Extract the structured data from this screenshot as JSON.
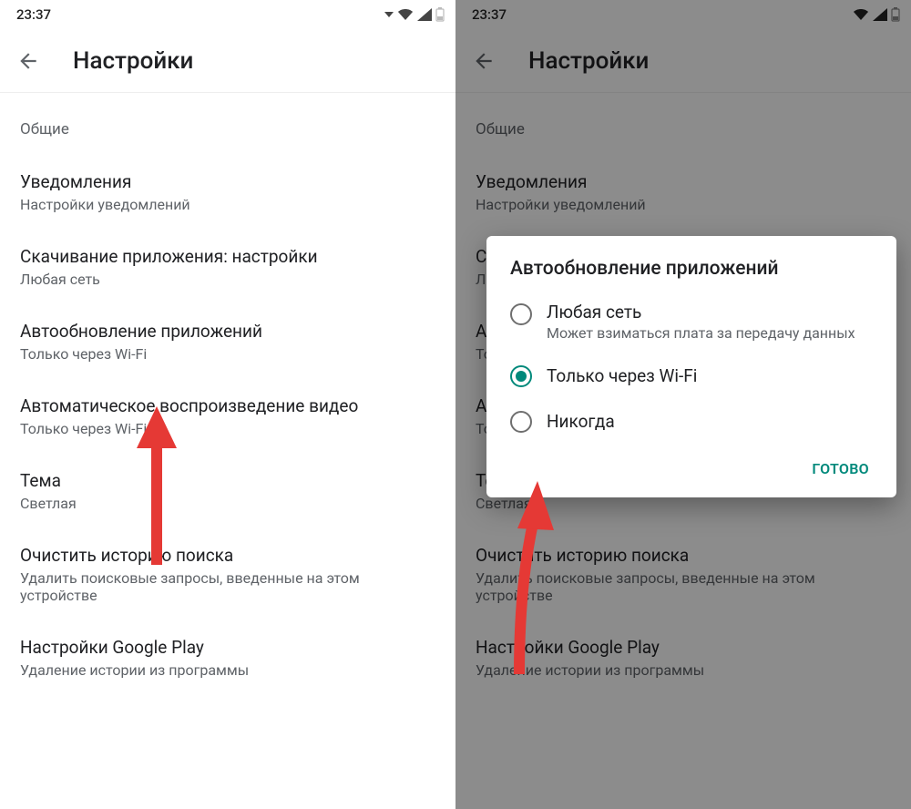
{
  "status": {
    "time": "23:37"
  },
  "appbar": {
    "title": "Настройки"
  },
  "section": {
    "label": "Общие"
  },
  "settings": {
    "notifications": {
      "name": "Уведомления",
      "sub": "Настройки уведомлений"
    },
    "download": {
      "name": "Скачивание приложения: настройки",
      "sub": "Любая сеть"
    },
    "autoupdate": {
      "name": "Автообновление приложений",
      "sub": "Только через Wi-Fi"
    },
    "autoplay": {
      "name": "Автоматическое воспроизведение видео",
      "sub": "Только через Wi-Fi"
    },
    "theme": {
      "name": "Тема",
      "sub": "Светлая"
    },
    "clearhistory": {
      "name": "Очистить историю поиска",
      "sub": "Удалить поисковые запросы, введенные на этом устройстве"
    },
    "playsettings": {
      "name": "Настройки Google Play",
      "sub": "Удаление истории из программы"
    }
  },
  "dialog": {
    "title": "Автообновление приложений",
    "opt_any": {
      "title": "Любая сеть",
      "sub": "Может взиматься плата за передачу данных"
    },
    "opt_wifi": {
      "title": "Только через Wi-Fi"
    },
    "opt_never": {
      "title": "Никогда"
    },
    "done": "ГОТОВО"
  }
}
